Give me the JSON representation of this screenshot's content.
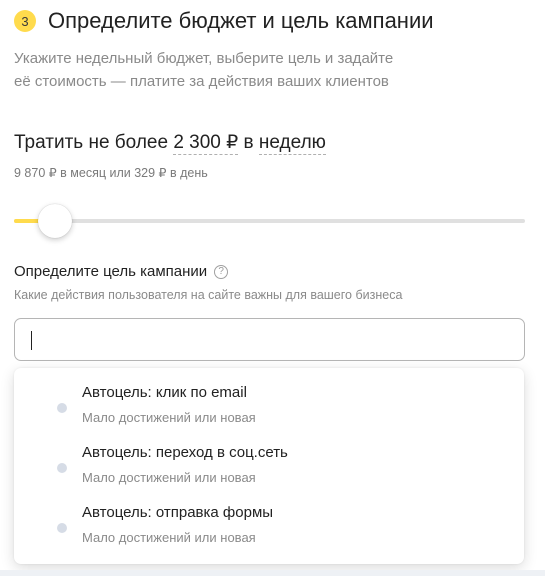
{
  "step": {
    "number": "3",
    "title": "Определите бюджет и цель кампании",
    "subtitle_line1": "Укажите недельный бюджет, выберите цель и задайте",
    "subtitle_line2": "её стоимость — платите за действия ваших клиентов"
  },
  "budget": {
    "prefix": "Тратить не более",
    "amount": "2 300",
    "currency": "₽",
    "preposition": "в",
    "period": "неделю",
    "hint": "9 870 ₽ в месяц или 329 ₽ в день",
    "slider_position_fraction": 0.08
  },
  "goal": {
    "title": "Определите цель кампании",
    "help_icon": "question-circle-icon",
    "subtitle": "Какие действия пользователя на сайте важны для вашего бизнеса",
    "input_value": "",
    "options": [
      {
        "title": "Автоцель: клик по email",
        "subtitle": "Мало достижений или новая"
      },
      {
        "title": "Автоцель: переход в соц.сеть",
        "subtitle": "Мало достижений или новая"
      },
      {
        "title": "Автоцель: отправка формы",
        "subtitle": "Мало достижений или новая"
      }
    ]
  },
  "colors": {
    "accent": "#ffdb4d",
    "text_primary": "#222222",
    "text_secondary": "#8a8a8a",
    "status_dot": "#d6dce6"
  }
}
